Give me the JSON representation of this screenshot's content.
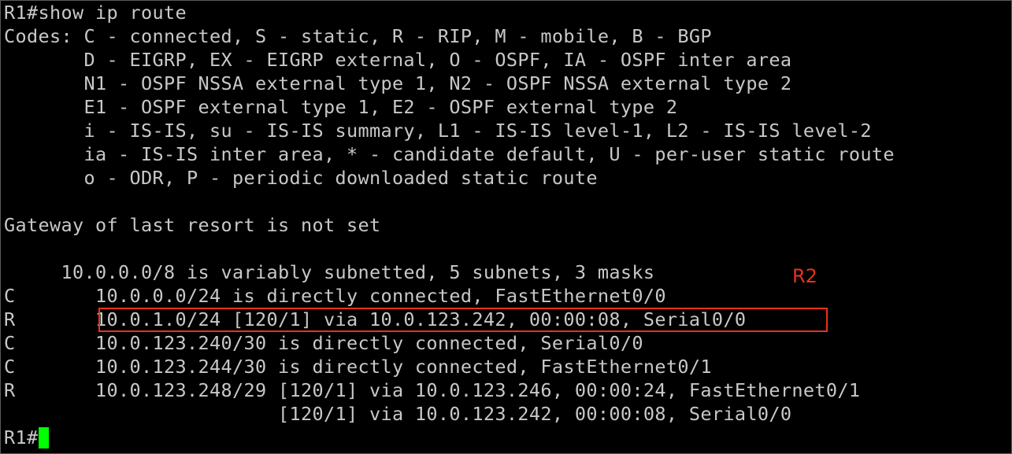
{
  "terminal": {
    "lines": [
      "R1#show ip route",
      "Codes: C - connected, S - static, R - RIP, M - mobile, B - BGP",
      "       D - EIGRP, EX - EIGRP external, O - OSPF, IA - OSPF inter area",
      "       N1 - OSPF NSSA external type 1, N2 - OSPF NSSA external type 2",
      "       E1 - OSPF external type 1, E2 - OSPF external type 2",
      "       i - IS-IS, su - IS-IS summary, L1 - IS-IS level-1, L2 - IS-IS level-2",
      "       ia - IS-IS inter area, * - candidate default, U - per-user static route",
      "       o - ODR, P - periodic downloaded static route",
      "",
      "Gateway of last resort is not set",
      "",
      "     10.0.0.0/8 is variably subnetted, 5 subnets, 3 masks",
      "C       10.0.0.0/24 is directly connected, FastEthernet0/0",
      "R       10.0.1.0/24 [120/1] via 10.0.123.242, 00:00:08, Serial0/0",
      "C       10.0.123.240/30 is directly connected, Serial0/0",
      "C       10.0.123.244/30 is directly connected, FastEthernet0/1",
      "R       10.0.123.248/29 [120/1] via 10.0.123.246, 00:00:24, FastEthernet0/1",
      "                        [120/1] via 10.0.123.242, 00:00:08, Serial0/0"
    ],
    "prompt": "R1#"
  },
  "annotation": {
    "label": "R2",
    "color": "#e8321e"
  },
  "colors": {
    "background": "#000000",
    "text": "#c8c8c8",
    "cursor": "#00ff00",
    "highlight": "#e8321e"
  }
}
